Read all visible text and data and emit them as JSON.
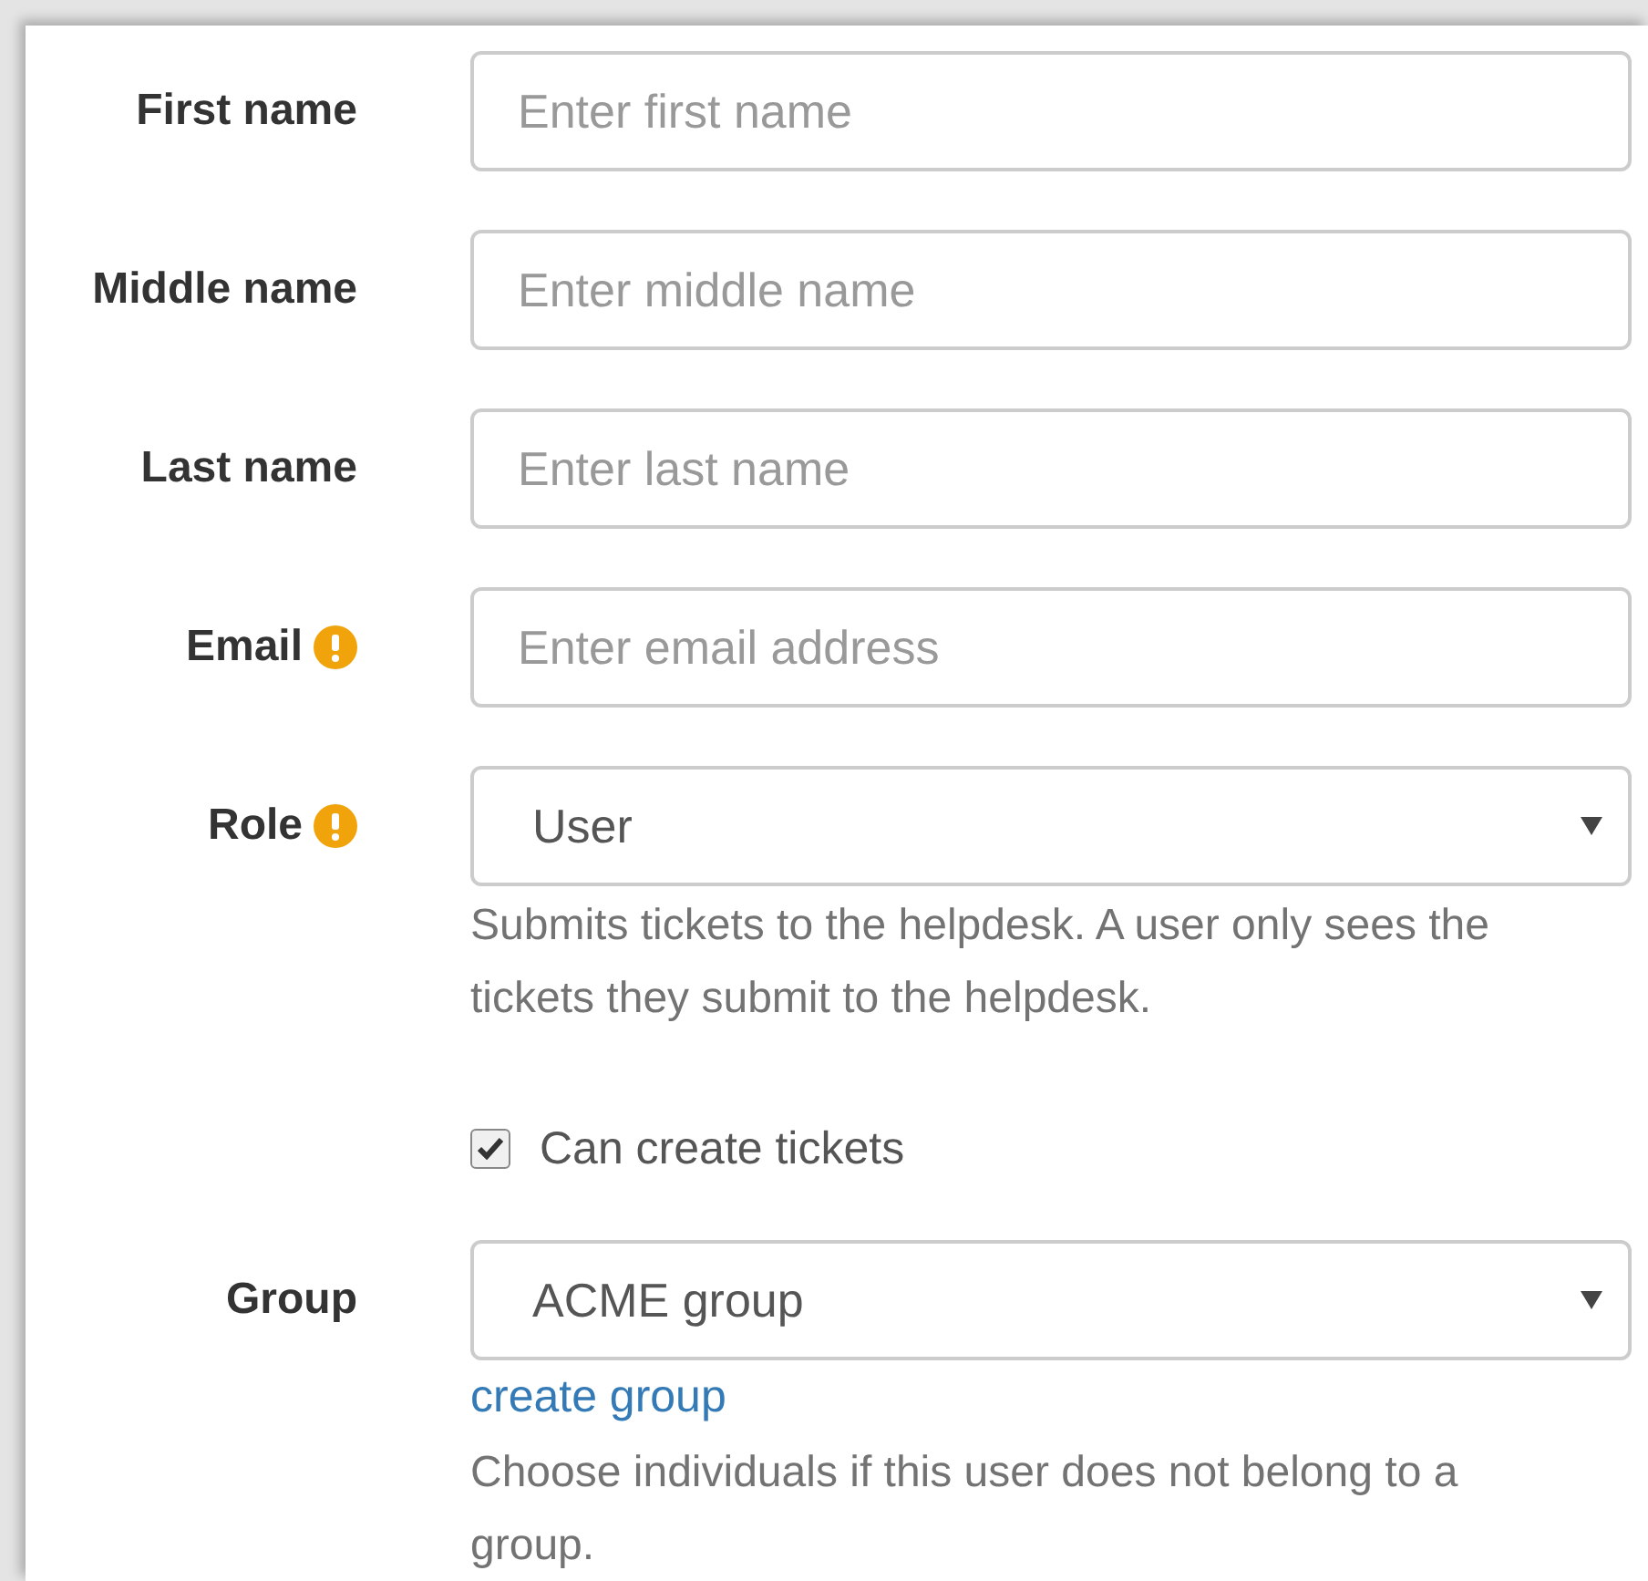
{
  "form": {
    "rows": [
      {
        "kind": "text",
        "label": "First name",
        "required": false,
        "placeholder": "Enter first name"
      },
      {
        "kind": "text",
        "label": "Middle name",
        "required": false,
        "placeholder": "Enter middle name"
      },
      {
        "kind": "text",
        "label": "Last name",
        "required": false,
        "placeholder": "Enter last name"
      },
      {
        "kind": "text",
        "label": "Email",
        "required": true,
        "placeholder": "Enter email address"
      },
      {
        "kind": "select",
        "label": "Role",
        "required": true,
        "value": "User",
        "help": "Submits tickets to the helpdesk. A user only sees the tickets they submit to the helpdesk."
      },
      {
        "kind": "checkbox",
        "label": "Can create tickets",
        "checked": true
      },
      {
        "kind": "select",
        "label": "Group",
        "required": false,
        "value": "ACME group",
        "link": "create group",
        "help": "Choose individuals if this user does not belong to a group."
      }
    ]
  }
}
